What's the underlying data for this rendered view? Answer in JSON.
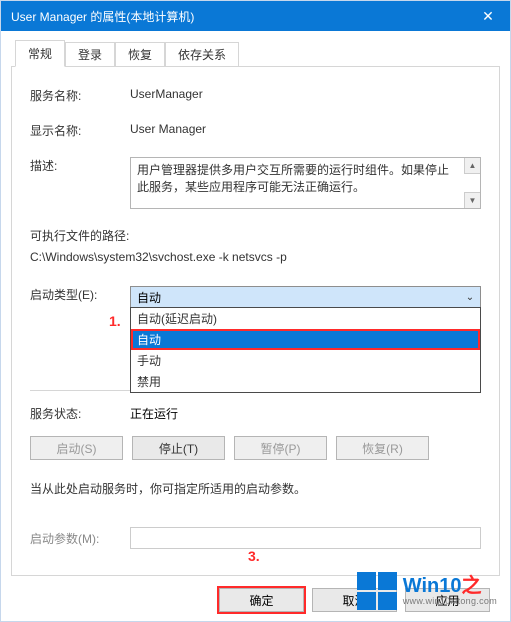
{
  "titlebar": {
    "title": "User Manager 的属性(本地计算机)"
  },
  "tabs": {
    "t0": "常规",
    "t1": "登录",
    "t2": "恢复",
    "t3": "依存关系"
  },
  "labels": {
    "service_name": "服务名称:",
    "display_name": "显示名称:",
    "description": "描述:",
    "exe_path": "可执行文件的路径:",
    "startup_type": "启动类型(E):",
    "service_status": "服务状态:",
    "start_param_note": "当从此处启动服务时，你可指定所适用的启动参数。",
    "start_params": "启动参数(M):"
  },
  "values": {
    "service_name": "UserManager",
    "display_name": "User Manager",
    "description": "用户管理器提供多用户交互所需要的运行时组件。如果停止此服务，某些应用程序可能无法正确运行。",
    "exe_path": "C:\\Windows\\system32\\svchost.exe -k netsvcs -p",
    "service_status": "正在运行"
  },
  "startup": {
    "selected": "自动",
    "options": {
      "o0": "自动(延迟启动)",
      "o1": "自动",
      "o2": "手动",
      "o3": "禁用"
    }
  },
  "buttons": {
    "start": "启动(S)",
    "stop": "停止(T)",
    "pause": "暂停(P)",
    "resume": "恢复(R)",
    "ok": "确定",
    "cancel": "取消",
    "apply": "应用"
  },
  "annotations": {
    "a1": "1.",
    "a3": "3."
  },
  "watermark": {
    "brand_main": "Win10",
    "brand_zhi": "之",
    "url": "www.win10xitong.com"
  }
}
